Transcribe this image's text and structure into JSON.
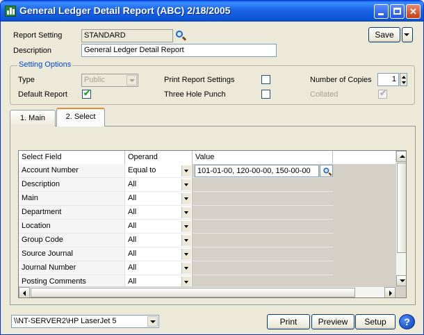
{
  "window": {
    "title": "General Ledger Detail Report (ABC) 2/18/2005"
  },
  "header": {
    "report_setting_label": "Report Setting",
    "report_setting_value": "STANDARD",
    "description_label": "Description",
    "description_value": "General Ledger Detail Report",
    "save_label": "Save"
  },
  "setting_options": {
    "title": "Setting Options",
    "type_label": "Type",
    "type_value": "Public",
    "default_report_label": "Default Report",
    "default_report_checked": true,
    "print_report_settings_label": "Print Report Settings",
    "print_report_settings_checked": false,
    "three_hole_punch_label": "Three Hole Punch",
    "three_hole_punch_checked": false,
    "number_of_copies_label": "Number of Copies",
    "number_of_copies_value": "1",
    "collated_label": "Collated",
    "collated_checked": true
  },
  "tabs": [
    {
      "label": "1. Main",
      "active": false
    },
    {
      "label": "2. Select",
      "active": true
    }
  ],
  "grid": {
    "columns": [
      "Select Field",
      "Operand",
      "Value"
    ],
    "rows": [
      {
        "field": "Account Number",
        "operand": "Equal to",
        "value": "101-01-00, 120-00-00, 150-00-00"
      },
      {
        "field": "Description",
        "operand": "All",
        "value": ""
      },
      {
        "field": "Main",
        "operand": "All",
        "value": ""
      },
      {
        "field": "Department",
        "operand": "All",
        "value": ""
      },
      {
        "field": "Location",
        "operand": "All",
        "value": ""
      },
      {
        "field": "Group Code",
        "operand": "All",
        "value": ""
      },
      {
        "field": "Source Journal",
        "operand": "All",
        "value": ""
      },
      {
        "field": "Journal Number",
        "operand": "All",
        "value": ""
      },
      {
        "field": "Posting Comments",
        "operand": "All",
        "value": ""
      }
    ]
  },
  "footer": {
    "printer": "\\\\NT-SERVER2\\HP LaserJet 5",
    "print_label": "Print",
    "preview_label": "Preview",
    "setup_label": "Setup",
    "help_label": "?"
  }
}
